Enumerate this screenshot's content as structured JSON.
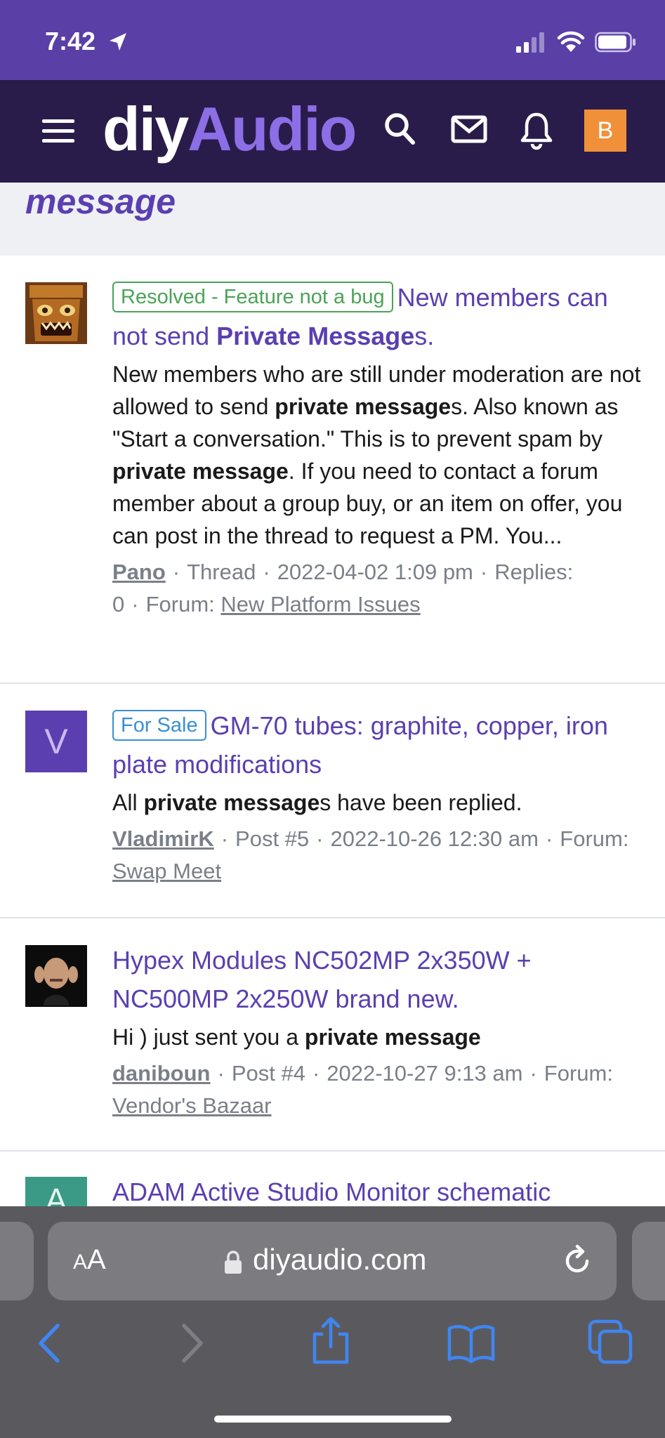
{
  "status": {
    "time": "7:42"
  },
  "header": {
    "logo_part1": "diy",
    "logo_part2": "Audio",
    "avatar_letter": "B"
  },
  "page": {
    "title_fragment": "message"
  },
  "results": [
    {
      "badge": "Resolved - Feature not a bug",
      "title_pre": "New members can not send ",
      "title_bold": "Private Message",
      "title_post": "s.",
      "snippet": [
        {
          "t": "New members who are still under moderation are not allowed to send "
        },
        {
          "b": "private message"
        },
        {
          "t": "s. Also known as \"Start a conversation.\" This is to prevent spam by "
        },
        {
          "b": "private message"
        },
        {
          "t": ". If you need to contact a forum member about a group buy, or an item on offer, you can post in the thread to request a PM. You..."
        }
      ],
      "user": "Pano",
      "type": "Thread",
      "date": "2022-04-02 1:09 pm",
      "replies": "Replies: 0",
      "forum_label": "Forum:",
      "forum": "New Platform Issues"
    },
    {
      "badge": "For Sale",
      "avatar_letter": "V",
      "title": "GM-70 tubes: graphite, copper, iron plate modifications",
      "snippet_pre": "All ",
      "snippet_bold": "private message",
      "snippet_post": "s have been replied.",
      "user": "VladimirK",
      "type": "Post #5",
      "date": "2022-10-26 12:30 am",
      "forum_label": "Forum:",
      "forum": "Swap Meet"
    },
    {
      "title": "Hypex Modules NC502MP 2x350W + NC500MP 2x250W brand new.",
      "snippet_pre": "Hi ) just sent you a ",
      "snippet_bold": "private message",
      "user": "daniboun",
      "type": "Post #4",
      "date": "2022-10-27 9:13 am",
      "forum_label": "Forum:",
      "forum": "Vendor's Bazaar"
    },
    {
      "avatar_letter": "A",
      "title": "ADAM Active Studio Monitor schematic"
    }
  ],
  "browser": {
    "aa_label": "AA",
    "url": "diyaudio.com"
  },
  "colors": {
    "brand_purple": "#5b3fb0",
    "header_bg": "#2a1c4a",
    "status_bg": "#5a3fa6",
    "accent_orange": "#f0913a"
  }
}
